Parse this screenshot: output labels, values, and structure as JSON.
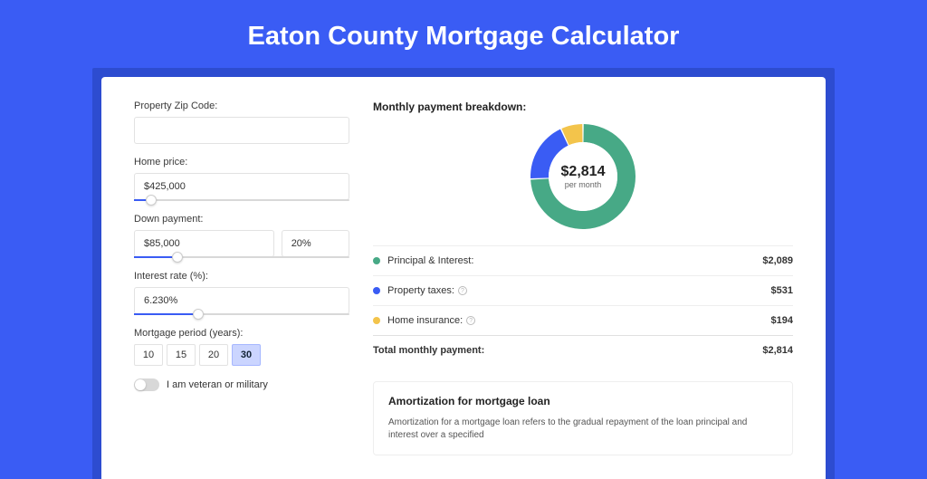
{
  "title": "Eaton County Mortgage Calculator",
  "form": {
    "zip_label": "Property Zip Code:",
    "zip_value": "",
    "home_price_label": "Home price:",
    "home_price_value": "$425,000",
    "home_price_slider_pct": 8,
    "down_payment_label": "Down payment:",
    "down_payment_value": "$85,000",
    "down_payment_pct_value": "20%",
    "down_payment_slider_pct": 20,
    "interest_label": "Interest rate (%):",
    "interest_value": "6.230%",
    "interest_slider_pct": 30,
    "period_label": "Mortgage period (years):",
    "periods": [
      "10",
      "15",
      "20",
      "30"
    ],
    "period_active_index": 3,
    "veteran_label": "I am veteran or military"
  },
  "colors": {
    "pi": "#47a986",
    "tax": "#3a5cf4",
    "ins": "#f3c44b"
  },
  "breakdown": {
    "title": "Monthly payment breakdown:",
    "total": "$2,814",
    "total_sub": "per month",
    "rows": [
      {
        "label": "Principal & Interest:",
        "value": "$2,089",
        "color": "pi",
        "help": false
      },
      {
        "label": "Property taxes:",
        "value": "$531",
        "color": "tax",
        "help": true
      },
      {
        "label": "Home insurance:",
        "value": "$194",
        "color": "ins",
        "help": true
      }
    ],
    "total_label": "Total monthly payment:"
  },
  "amort": {
    "title": "Amortization for mortgage loan",
    "text": "Amortization for a mortgage loan refers to the gradual repayment of the loan principal and interest over a specified"
  },
  "chart_data": {
    "type": "pie",
    "title": "Monthly payment breakdown",
    "series": [
      {
        "name": "Principal & Interest",
        "value": 2089,
        "color": "#47a986"
      },
      {
        "name": "Property taxes",
        "value": 531,
        "color": "#3a5cf4"
      },
      {
        "name": "Home insurance",
        "value": 194,
        "color": "#f3c44b"
      }
    ],
    "total": 2814,
    "center_label": "$2,814",
    "center_sub": "per month"
  }
}
